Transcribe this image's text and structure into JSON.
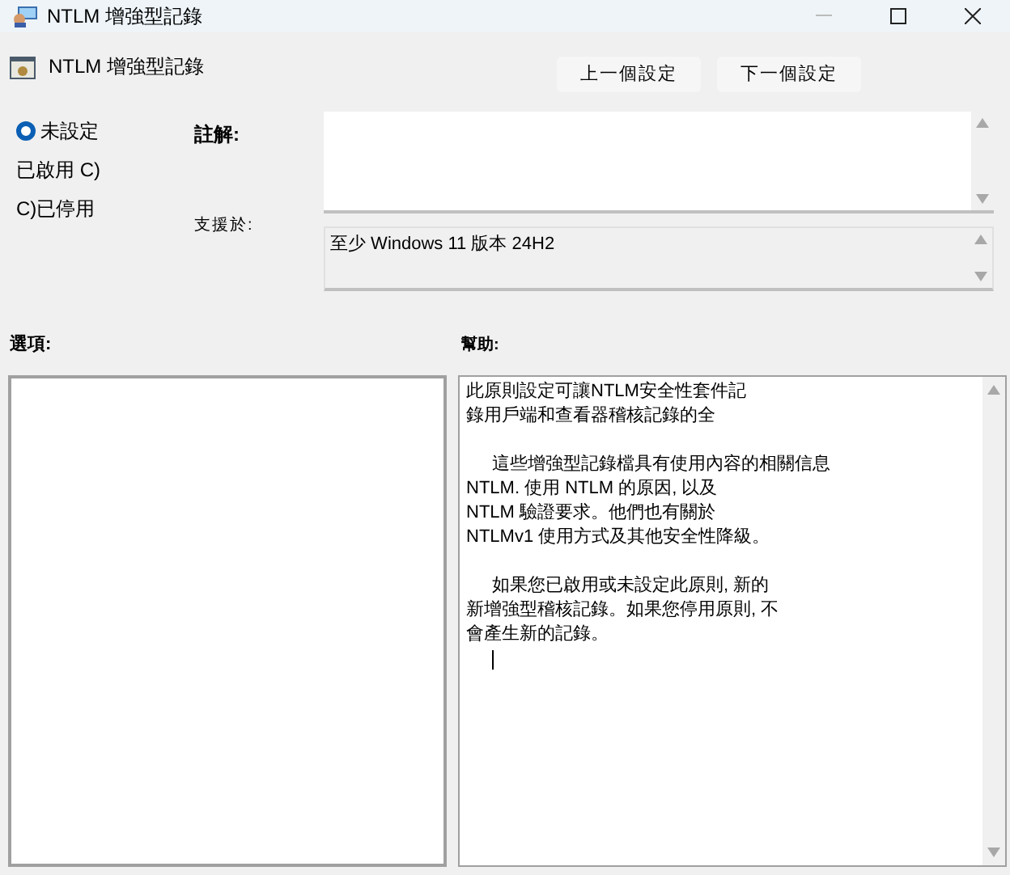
{
  "window": {
    "title": "NTLM 增強型記錄"
  },
  "header": {
    "title": "NTLM 增強型記錄"
  },
  "nav_buttons": [
    "上一個設定",
    "下一個設定"
  ],
  "options": [
    {
      "label": "未設定",
      "selected": true
    },
    {
      "label": "已啟用 C)",
      "selected": false
    },
    {
      "label": "C)已停用",
      "selected": false
    }
  ],
  "comment": {
    "label": "註解:"
  },
  "supported_on": {
    "label": "支援於:",
    "value": "至少 Windows 11 版本 24H2"
  },
  "options_label": "選項:",
  "help_label": "幫助:",
  "help": [
    {
      "indent": false,
      "lines": [
        "此原則設定可讓NTLM安全性套件記",
        "錄用戶端和查看器稽核記錄的全"
      ]
    },
    {
      "indent": true,
      "lines": [
        "這些增強型記錄檔具有使用內容的相關信息",
        "NTLM. 使用 NTLM 的原因, 以及",
        "NTLM 驗證要求。他們也有關於",
        "NTLMv1 使用方式及其他安全性降級。"
      ]
    },
    {
      "indent": true,
      "lines": [
        "如果您已啟用或未設定此原則, 新的",
        "新增強型稽核記錄。如果您停用原則, 不",
        "會產生新的記錄。"
      ]
    }
  ]
}
